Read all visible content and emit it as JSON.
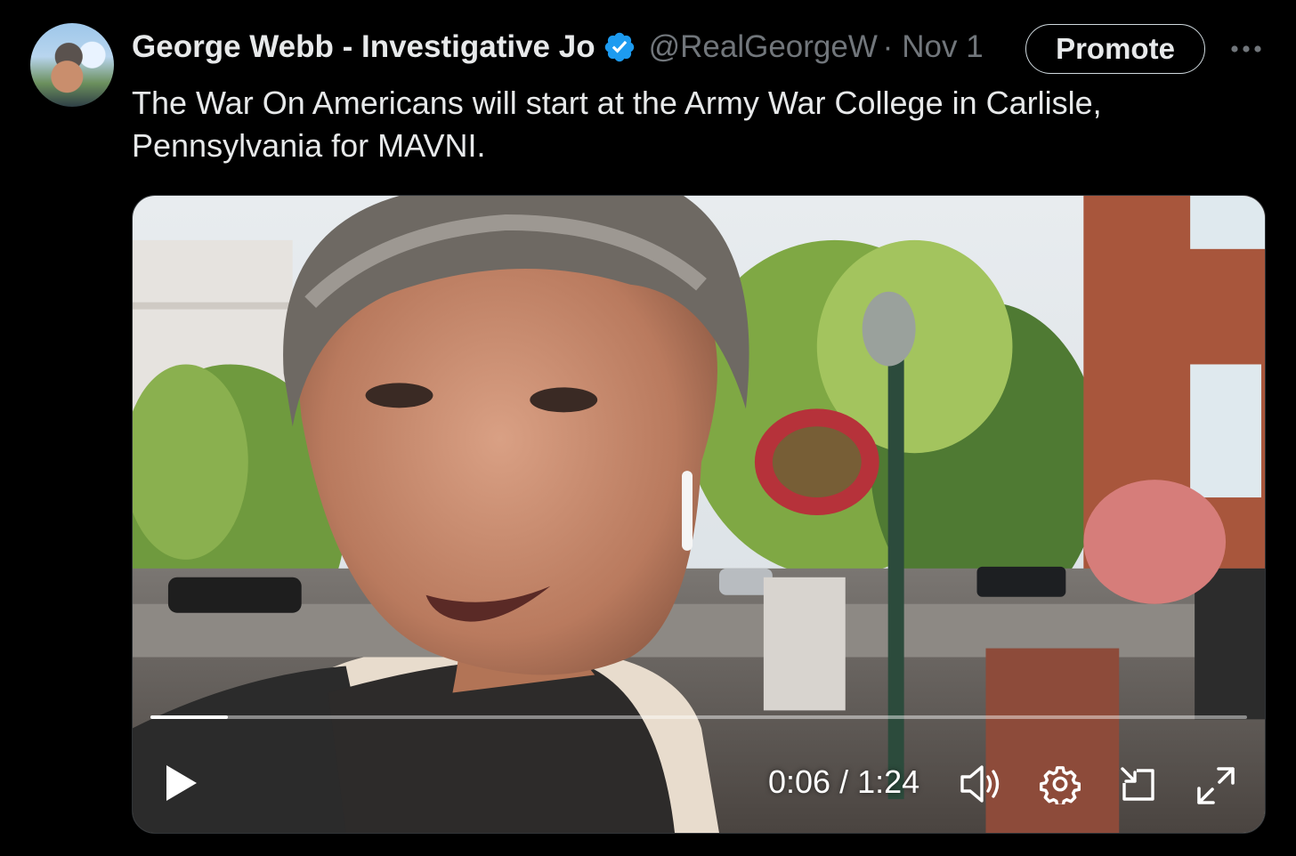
{
  "tweet": {
    "author_name": "George Webb - Investigative Jo",
    "handle": "@RealGeorgeW",
    "separator": "·",
    "date": "Nov 1",
    "promote_label": "Promote",
    "text": "The War On Americans will start at the Army War College in Carlisle, Pennsylvania for MAVNI."
  },
  "video": {
    "current_time": "0:06",
    "duration": "1:24",
    "time_separator": "/",
    "progress_fraction": 0.071,
    "controls": [
      "play-icon",
      "volume-icon",
      "settings-icon",
      "picture-in-picture-icon",
      "fullscreen-icon"
    ]
  },
  "colors": {
    "background": "#000000",
    "text_primary": "#e7e9ea",
    "text_secondary": "#71767b",
    "verified_badge": "#1d9bf0"
  }
}
